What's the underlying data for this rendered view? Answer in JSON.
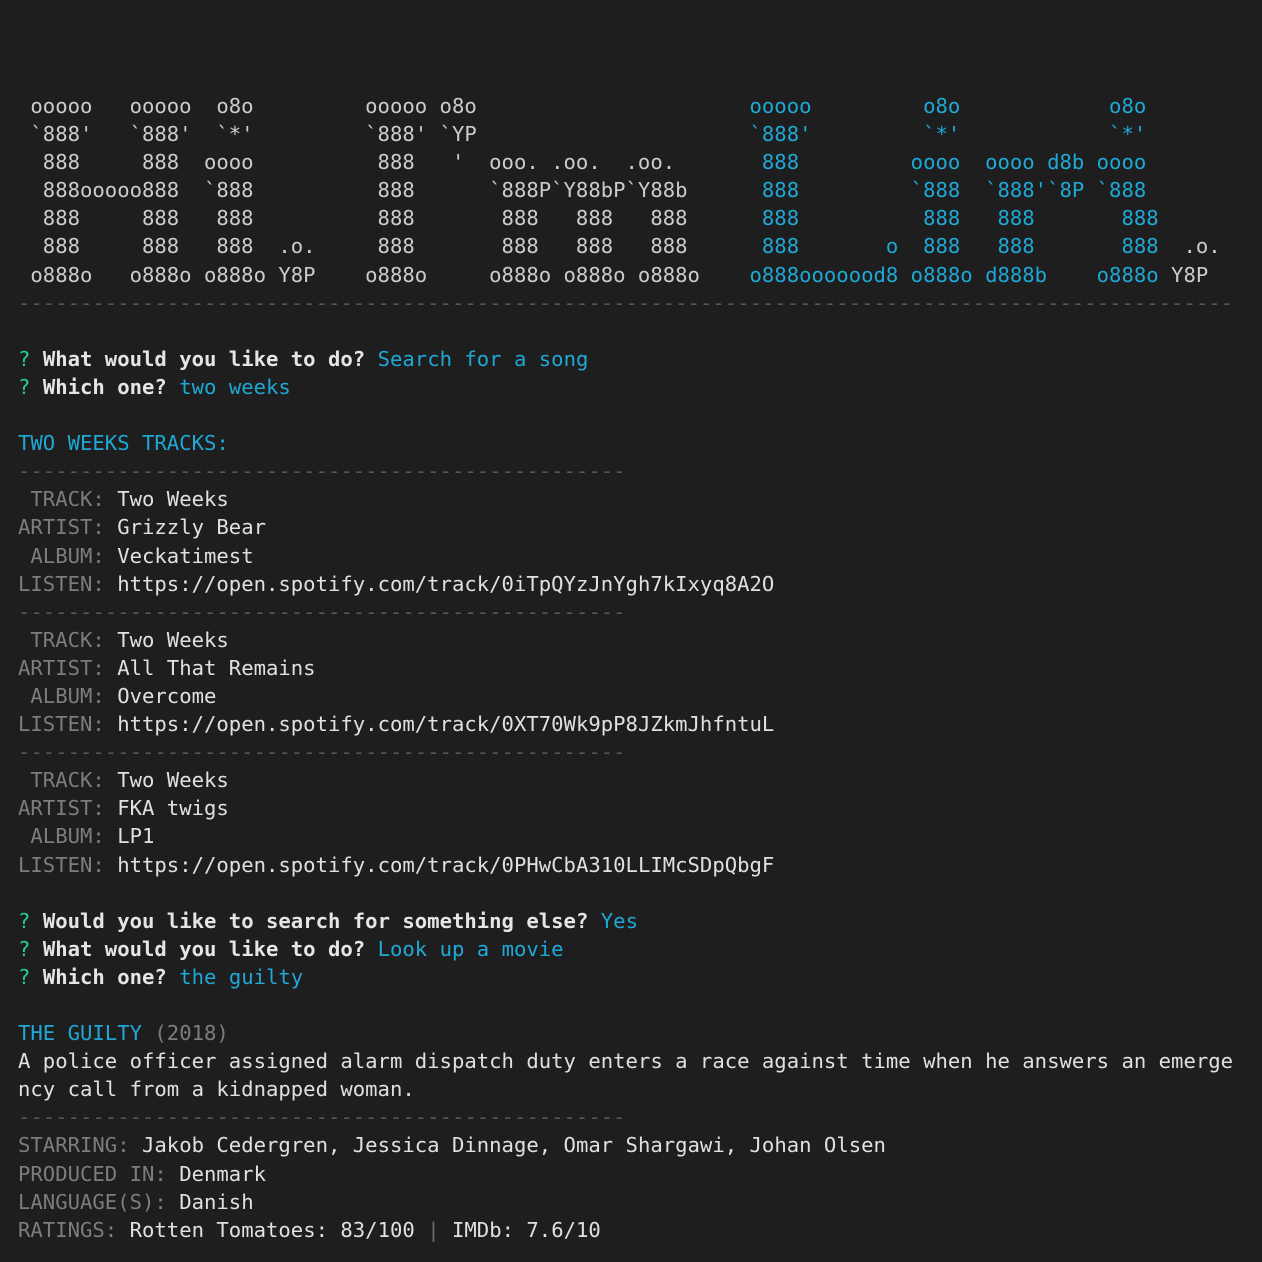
{
  "banner": {
    "lines": [
      {
        "w": " ooooo   ooooo  o8o         ooooo o8o",
        "b": "ooooo         o8o            o8o",
        "t": ""
      },
      {
        "w": " `888'   `888'  `*'         `888' `YP",
        "b": "`888'         `*'            `*'",
        "t": ""
      },
      {
        "w": "  888     888  oooo          888   '  ooo. .oo.  .oo.",
        "b": " 888         oooo  oooo d8b oooo",
        "t": ""
      },
      {
        "w": "  888ooooo888  `888          888      `888P`Y88bP`Y88b",
        "b": " 888         `888  `888'`8P `888",
        "t": ""
      },
      {
        "w": "  888     888   888          888       888   888   888",
        "b": " 888          888   888       888",
        "t": ""
      },
      {
        "w": "  888     888   888  .o.     888       888   888   888",
        "b": " 888       o  888   888       888",
        "t": "  .o."
      },
      {
        "w": " o888o   o888o o888o Y8P    o888o     o888o o888o o888o",
        "b": "o888ooooood8 o888o d888b    o888o",
        "t": " Y8P"
      }
    ],
    "divider": "--------------------------------------------------------------------------------------------------"
  },
  "prompt_mark": "?",
  "session1": {
    "q1": "What would you like to do?",
    "a1": "Search for a song",
    "q2": "Which one?",
    "a2": "two weeks"
  },
  "tracks_header": "TWO WEEKS TRACKS:",
  "short_divider": "-------------------------------------------------",
  "labels": {
    "track": " TRACK:",
    "artist": "ARTIST:",
    "album": " ALBUM:",
    "listen": "LISTEN:"
  },
  "tracks": [
    {
      "track": "Two Weeks",
      "artist": "Grizzly Bear",
      "album": "Veckatimest",
      "listen": "https://open.spotify.com/track/0iTpQYzJnYgh7kIxyq8A2O"
    },
    {
      "track": "Two Weeks",
      "artist": "All That Remains",
      "album": "Overcome",
      "listen": "https://open.spotify.com/track/0XT70Wk9pP8JZkmJhfntuL"
    },
    {
      "track": "Two Weeks",
      "artist": "FKA twigs",
      "album": "LP1",
      "listen": "https://open.spotify.com/track/0PHwCbA310LLIMcSDpQbgF"
    }
  ],
  "session2": {
    "q1": "Would you like to search for something else?",
    "a1": "Yes",
    "q2": "What would you like to do?",
    "a2": "Look up a movie",
    "q3": "Which one?",
    "a3": "the guilty"
  },
  "movie": {
    "title": "THE GUILTY",
    "year": "(2018)",
    "plot": "A police officer assigned alarm dispatch duty enters a race against time when he answers an emergency call from a kidnapped woman.",
    "starring_label": "STARRING:",
    "starring": "Jakob Cedergren, Jessica Dinnage, Omar Shargawi, Johan Olsen",
    "produced_label": "PRODUCED IN:",
    "produced": "Denmark",
    "language_label": "LANGUAGE(S):",
    "language": "Danish",
    "ratings_label": "RATINGS:",
    "rt": "Rotten Tomatoes: 83/100",
    "sep": "|",
    "imdb": "IMDb: 7.6/10"
  },
  "colors": {
    "background": "#1e1e1e",
    "accent": "#1fa8d6",
    "prompt": "#23d18b",
    "label": "#7d7d7d"
  }
}
